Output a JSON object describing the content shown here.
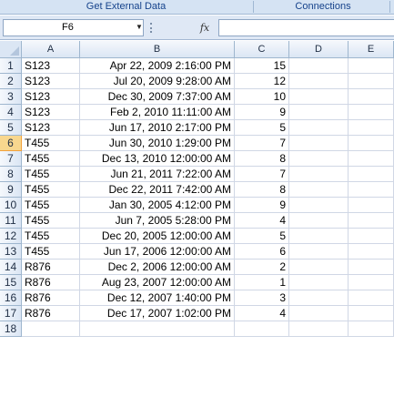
{
  "ribbon": {
    "groups": [
      {
        "label": "Get External Data"
      },
      {
        "label": "Connections"
      }
    ]
  },
  "formula_bar": {
    "name_box": "F6",
    "fx_label": "fx",
    "formula": ""
  },
  "columns": [
    "A",
    "B",
    "C",
    "D",
    "E"
  ],
  "active_cell": "F6",
  "rows": [
    {
      "n": "1",
      "a": "S123",
      "b": "Apr 22, 2009 2:16:00 PM",
      "c": "15"
    },
    {
      "n": "2",
      "a": "S123",
      "b": "Jul 20, 2009 9:28:00 AM",
      "c": "12"
    },
    {
      "n": "3",
      "a": "S123",
      "b": "Dec 30, 2009 7:37:00 AM",
      "c": "10"
    },
    {
      "n": "4",
      "a": "S123",
      "b": "Feb 2, 2010 11:11:00 AM",
      "c": "9"
    },
    {
      "n": "5",
      "a": "S123",
      "b": "Jun 17, 2010 2:17:00 PM",
      "c": "5"
    },
    {
      "n": "6",
      "a": "T455",
      "b": "Jun 30, 2010 1:29:00 PM",
      "c": "7"
    },
    {
      "n": "7",
      "a": "T455",
      "b": "Dec 13, 2010 12:00:00 AM",
      "c": "8"
    },
    {
      "n": "8",
      "a": "T455",
      "b": "Jun 21, 2011 7:22:00 AM",
      "c": "7"
    },
    {
      "n": "9",
      "a": "T455",
      "b": "Dec 22, 2011 7:42:00 AM",
      "c": "8"
    },
    {
      "n": "10",
      "a": "T455",
      "b": "Jan 30, 2005 4:12:00 PM",
      "c": "9"
    },
    {
      "n": "11",
      "a": "T455",
      "b": "Jun 7, 2005 5:28:00 PM",
      "c": "4"
    },
    {
      "n": "12",
      "a": "T455",
      "b": "Dec 20, 2005 12:00:00 AM",
      "c": "5"
    },
    {
      "n": "13",
      "a": "T455",
      "b": "Jun 17, 2006 12:00:00 AM",
      "c": "6"
    },
    {
      "n": "14",
      "a": "R876",
      "b": "Dec 2, 2006 12:00:00 AM",
      "c": "2"
    },
    {
      "n": "15",
      "a": "R876",
      "b": "Aug 23, 2007 12:00:00 AM",
      "c": "1"
    },
    {
      "n": "16",
      "a": "R876",
      "b": "Dec 12, 2007 1:40:00 PM",
      "c": "3"
    },
    {
      "n": "17",
      "a": "R876",
      "b": "Dec 17, 2007 1:02:00 PM",
      "c": "4"
    },
    {
      "n": "18",
      "a": "",
      "b": "",
      "c": ""
    }
  ]
}
